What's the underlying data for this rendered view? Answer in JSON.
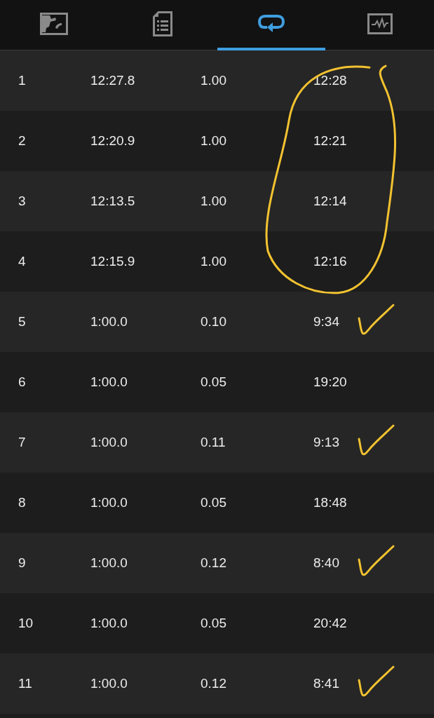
{
  "tabs": [
    {
      "kind": "map",
      "selected": false
    },
    {
      "kind": "document",
      "selected": false
    },
    {
      "kind": "repeat",
      "selected": true
    },
    {
      "kind": "chart",
      "selected": false
    }
  ],
  "rows": [
    {
      "column_1": "1",
      "column_2": "12:27.8",
      "column_3": "1.00",
      "column_4": "12:28",
      "circled": true,
      "ticked": false
    },
    {
      "column_1": "2",
      "column_2": "12:20.9",
      "column_3": "1.00",
      "column_4": "12:21",
      "circled": true,
      "ticked": false
    },
    {
      "column_1": "3",
      "column_2": "12:13.5",
      "column_3": "1.00",
      "column_4": "12:14",
      "circled": true,
      "ticked": false
    },
    {
      "column_1": "4",
      "column_2": "12:15.9",
      "column_3": "1.00",
      "column_4": "12:16",
      "circled": true,
      "ticked": false
    },
    {
      "column_1": "5",
      "column_2": "1:00.0",
      "column_3": "0.10",
      "column_4": "9:34",
      "circled": false,
      "ticked": true
    },
    {
      "column_1": "6",
      "column_2": "1:00.0",
      "column_3": "0.05",
      "column_4": "19:20",
      "circled": false,
      "ticked": false
    },
    {
      "column_1": "7",
      "column_2": "1:00.0",
      "column_3": "0.11",
      "column_4": "9:13",
      "circled": false,
      "ticked": true
    },
    {
      "column_1": "8",
      "column_2": "1:00.0",
      "column_3": "0.05",
      "column_4": "18:48",
      "circled": false,
      "ticked": false
    },
    {
      "column_1": "9",
      "column_2": "1:00.0",
      "column_3": "0.12",
      "column_4": "8:40",
      "circled": false,
      "ticked": true
    },
    {
      "column_1": "10",
      "column_2": "1:00.0",
      "column_3": "0.05",
      "column_4": "20:42",
      "circled": false,
      "ticked": false
    },
    {
      "column_1": "11",
      "column_2": "1:00.0",
      "column_3": "0.12",
      "column_4": "8:41",
      "circled": false,
      "ticked": true
    }
  ]
}
